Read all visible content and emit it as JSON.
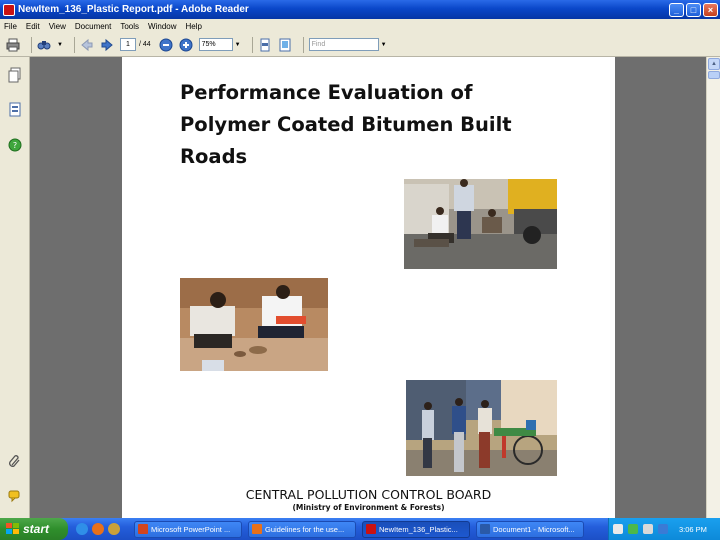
{
  "window": {
    "title": "NewItem_136_Plastic Report.pdf - Adobe Reader",
    "minimize": "_",
    "maximize": "□",
    "close": "×"
  },
  "menu": [
    "File",
    "Edit",
    "View",
    "Document",
    "Tools",
    "Window",
    "Help"
  ],
  "toolbar": {
    "page_number": "1",
    "page_total": "/ 44",
    "zoom": "75%",
    "find_placeholder": "Find"
  },
  "document": {
    "title_lines": [
      "Performance Evaluation of",
      "Polymer Coated  Bitumen Built",
      "Roads"
    ],
    "organization": "CENTRAL POLLUTION CONTROL BOARD",
    "ministry": "(Ministry of Environment & Forests)"
  },
  "taskbar": {
    "start_label": "start",
    "tasks": [
      {
        "label": "Microsoft PowerPoint ...",
        "active": false
      },
      {
        "label": "Guidelines for the use...",
        "active": false
      },
      {
        "label": "NewItem_136_Plastic...",
        "active": true
      },
      {
        "label": "Document1 - Microsoft...",
        "active": false
      }
    ],
    "clock": "3:06 PM"
  },
  "colors": {
    "titlebar": "#0a47c9",
    "chrome": "#ece9d8",
    "doc_background": "#6e6e6e",
    "taskbar": "#245edb",
    "start": "#2f8f2c"
  }
}
